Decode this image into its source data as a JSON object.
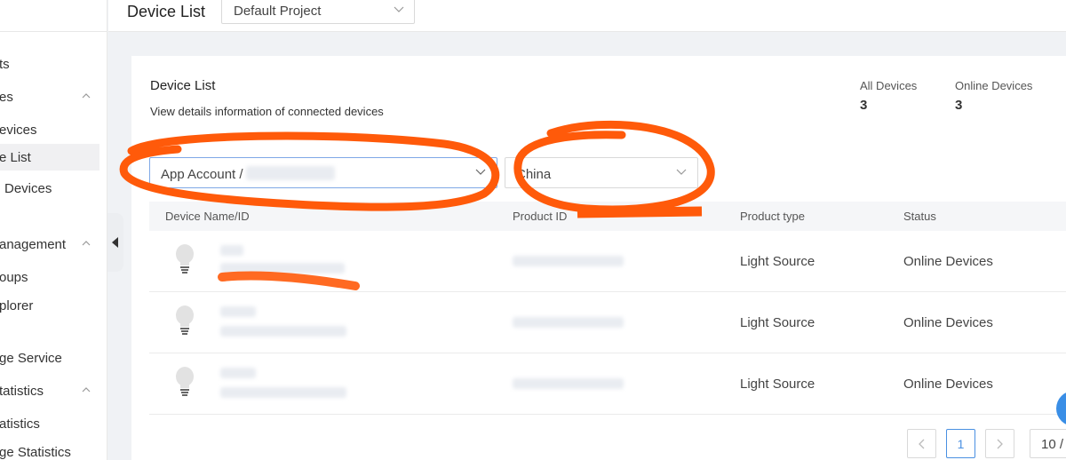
{
  "header": {
    "title": "Device List",
    "project_value": "Default Project"
  },
  "sidebar": {
    "items": [
      {
        "label": "ts"
      },
      {
        "label": "es"
      },
      {
        "label": "evices"
      },
      {
        "label": "e List"
      },
      {
        "label": "Devices"
      },
      {
        "label": "anagement"
      },
      {
        "label": "oups"
      },
      {
        "label": "plorer"
      },
      {
        "label": "ge Service"
      },
      {
        "label": "tatistics"
      },
      {
        "label": "atistics"
      },
      {
        "label": "ge Statistics"
      }
    ]
  },
  "card": {
    "title": "Device List",
    "subtitle": "View details information of connected devices",
    "stats": {
      "all_label": "All Devices",
      "all_value": "3",
      "online_label": "Online Devices",
      "online_value": "3"
    },
    "filters": {
      "account_value": "App Account /",
      "region_value": "China"
    },
    "table": {
      "columns": [
        "Device Name/ID",
        "Product ID",
        "Product type",
        "Status"
      ],
      "rows": [
        {
          "product_type": "Light Source",
          "status": "Online Devices"
        },
        {
          "product_type": "Light Source",
          "status": "Online Devices"
        },
        {
          "product_type": "Light Source",
          "status": "Online Devices"
        }
      ]
    },
    "pagination": {
      "current_page": "1",
      "page_size": "10 /"
    }
  },
  "colors": {
    "accent": "#4a90e2",
    "annotation": "#ff5a0a"
  }
}
